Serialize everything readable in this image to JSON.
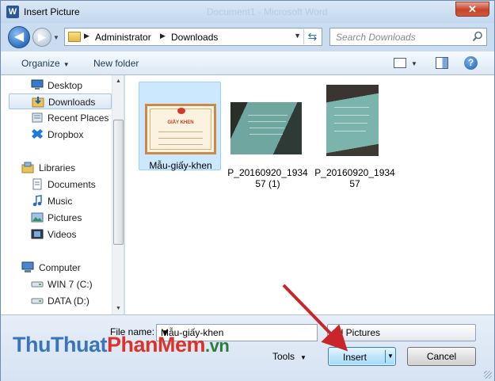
{
  "window": {
    "title": "Insert Picture",
    "app_icon": "W",
    "close_glyph": "✕",
    "title_ghost": "Document1 - Microsoft Word"
  },
  "address": {
    "crumbs": [
      "Administrator",
      "Downloads"
    ],
    "search_placeholder": "Search Downloads"
  },
  "toolbar": {
    "organize": "Organize",
    "new_folder": "New folder"
  },
  "nav": {
    "favorites": [
      {
        "label": "Desktop",
        "icon": "desktop-icon"
      },
      {
        "label": "Downloads",
        "icon": "downloads-icon"
      },
      {
        "label": "Recent Places",
        "icon": "recent-places-icon"
      },
      {
        "label": "Dropbox",
        "icon": "dropbox-icon"
      }
    ],
    "libraries_label": "Libraries",
    "libraries": [
      {
        "label": "Documents",
        "icon": "documents-icon"
      },
      {
        "label": "Music",
        "icon": "music-icon"
      },
      {
        "label": "Pictures",
        "icon": "pictures-icon"
      },
      {
        "label": "Videos",
        "icon": "videos-icon"
      }
    ],
    "computer_label": "Computer",
    "drives": [
      {
        "label": "WIN 7 (C:)",
        "icon": "drive-c-icon"
      },
      {
        "label": "DATA (D:)",
        "icon": "drive-d-icon"
      }
    ],
    "selected": "Downloads"
  },
  "files": [
    {
      "name_line1": "Mẫu-giấy-khen",
      "name_line2": "",
      "kind": "certificate",
      "selected": true
    },
    {
      "name_line1": "P_20160920_1934",
      "name_line2": "57 (1)",
      "kind": "photo",
      "selected": false
    },
    {
      "name_line1": "P_20160920_1934",
      "name_line2": "57",
      "kind": "photo",
      "selected": false
    }
  ],
  "certificate_title": "GIẤY KHEN",
  "bottom": {
    "file_name_label": "File name:",
    "file_name_value": "Mẫu-giấy-khen",
    "file_type_value": "All Pictures",
    "tools_label": "Tools",
    "insert_label": "Insert",
    "cancel_label": "Cancel"
  },
  "watermark": {
    "part1": "ThuThuat",
    "part2": "PhanMem",
    "part3": ".vn"
  },
  "colors": {
    "arrow": "#c8262a",
    "selection": "#cce8ff"
  }
}
